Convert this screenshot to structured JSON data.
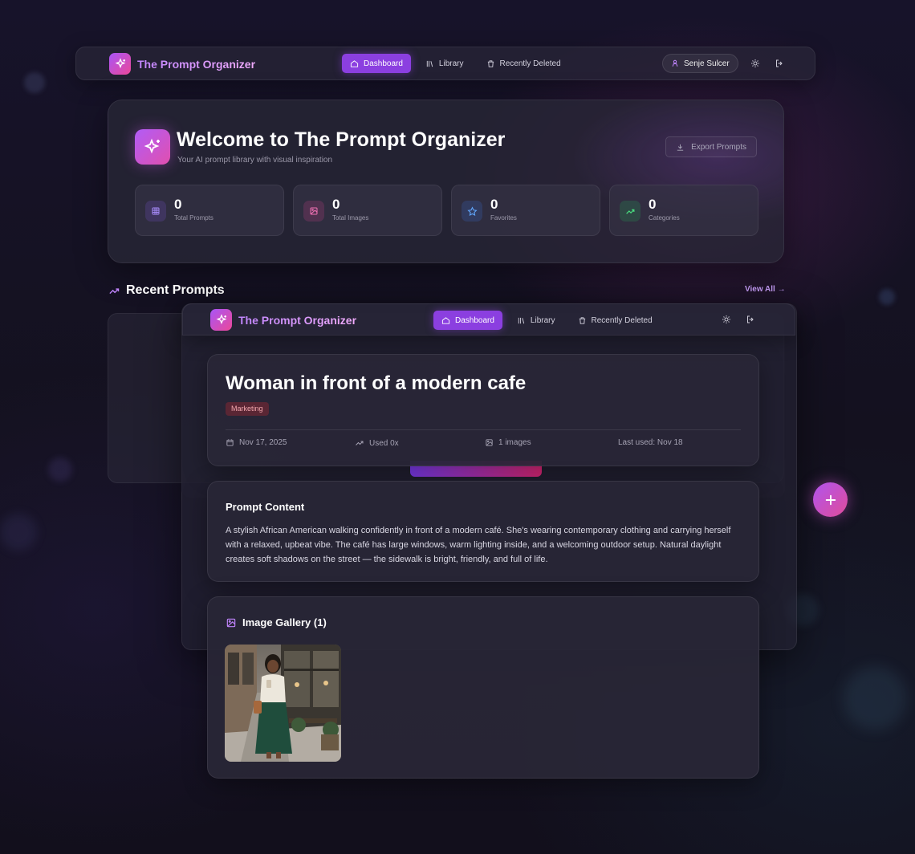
{
  "app": {
    "name": "The Prompt Organizer",
    "nav": {
      "dashboard": "Dashboard",
      "library": "Library",
      "recently_deleted": "Recently Deleted"
    },
    "overlay_nav": {
      "dashboard": "Dashboard",
      "library": "Library",
      "recently_deleted": "Recently Deleted"
    },
    "user": "Senje Sulcer"
  },
  "welcome": {
    "title": "Welcome to The Prompt Organizer",
    "subtitle": "Your AI prompt library with visual inspiration",
    "export_label": "Export Prompts"
  },
  "stats": [
    {
      "value": "0",
      "label": "Total Prompts",
      "icon": "grid-icon",
      "color": "#a78bfa"
    },
    {
      "value": "0",
      "label": "Total Images",
      "icon": "image-icon",
      "color": "#f472b6"
    },
    {
      "value": "0",
      "label": "Favorites",
      "icon": "star-icon",
      "color": "#60a5fa"
    },
    {
      "value": "0",
      "label": "Categories",
      "icon": "trend-icon",
      "color": "#4ade80"
    }
  ],
  "recent": {
    "title": "Recent Prompts",
    "view_all": "View All →"
  },
  "prompt": {
    "title": "Woman in front of a modern cafe",
    "tag": "Marketing",
    "created": "Nov 17, 2025",
    "used": "Used 0x",
    "images": "1 images",
    "last_used": "Last used: Nov 18",
    "content_title": "Prompt Content",
    "content": "A stylish African American walking confidently in front of a modern café. She's wearing contemporary clothing and carrying herself with a relaxed, upbeat vibe. The café has large windows, warm lighting inside, and a welcoming outdoor setup. Natural daylight creates soft shadows on the street — the sidewalk is bright, friendly, and full of life.",
    "gallery_title": "Image Gallery (1)"
  },
  "colors": {
    "accent": "#8b3fe0",
    "brand_gradient_start": "#a855f7",
    "brand_gradient_end": "#ec4899"
  }
}
